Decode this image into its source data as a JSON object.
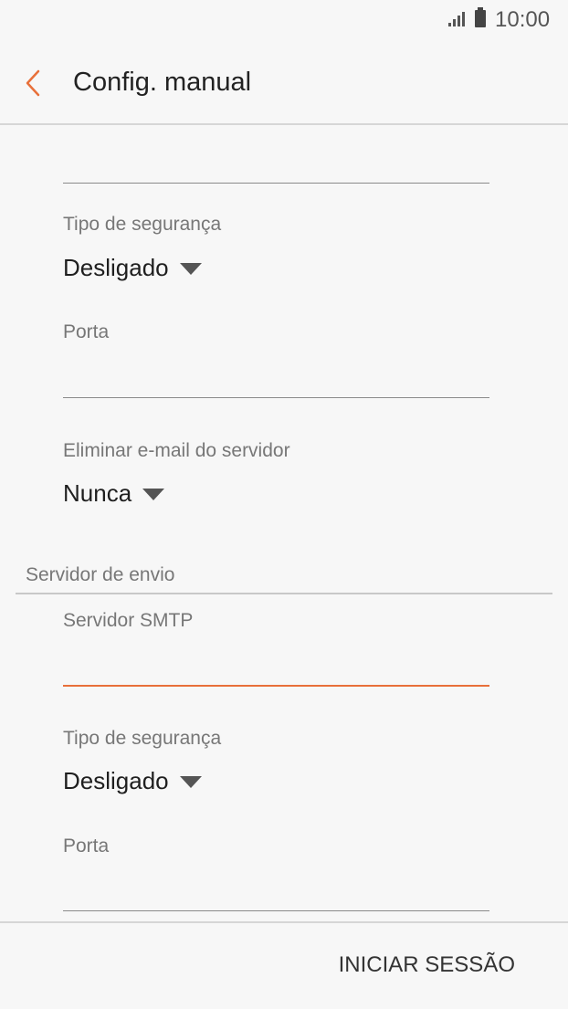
{
  "status_bar": {
    "time": "10:00",
    "signal_icon": "signal-icon",
    "battery_icon": "battery-icon"
  },
  "app_bar": {
    "title": "Config. manual",
    "back_icon": "chevron-left-icon"
  },
  "incoming": {
    "security_type_label": "Tipo de segurança",
    "security_type_value": "Desligado",
    "port_label": "Porta",
    "port_value": "",
    "delete_email_label": "Eliminar e-mail do servidor",
    "delete_email_value": "Nunca"
  },
  "outgoing": {
    "section_title": "Servidor de envio",
    "smtp_label": "Servidor SMTP",
    "smtp_value": "",
    "security_type_label": "Tipo de segurança",
    "security_type_value": "Desligado",
    "port_label": "Porta",
    "port_value": ""
  },
  "footer": {
    "sign_in_label": "INICIAR SESSÃO"
  },
  "colors": {
    "accent": "#e8703a",
    "background": "#f7f7f7"
  }
}
